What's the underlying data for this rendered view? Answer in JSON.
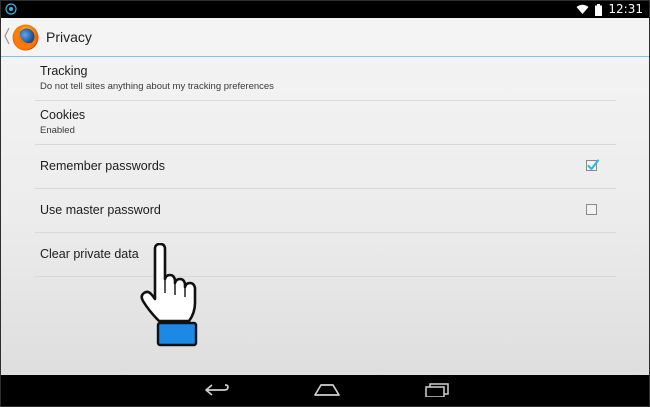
{
  "status_bar": {
    "time": "12:31",
    "icons": [
      "notification-icon",
      "wifi-icon",
      "battery-icon"
    ]
  },
  "action_bar": {
    "title": "Privacy",
    "icons": [
      "back-chevron-icon",
      "firefox-logo-icon"
    ]
  },
  "preferences": [
    {
      "title": "Tracking",
      "summary": "Do not tell sites anything about my tracking preferences"
    },
    {
      "title": "Cookies",
      "summary": "Enabled"
    },
    {
      "title": "Remember passwords",
      "checked": true
    },
    {
      "title": "Use master password",
      "checked": false
    },
    {
      "title": "Clear private data"
    }
  ],
  "nav_bar": {
    "buttons": [
      "back-icon",
      "home-icon",
      "recents-icon"
    ]
  },
  "colors": {
    "accent": "#33b5e5",
    "pointer_cuff": "#1e88e5"
  }
}
